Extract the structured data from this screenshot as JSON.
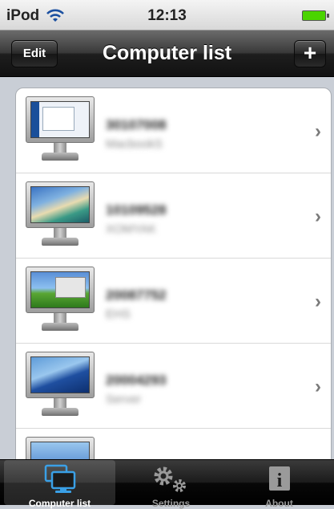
{
  "status_bar": {
    "carrier": "iPod",
    "time": "12:13"
  },
  "nav": {
    "edit_label": "Edit",
    "title": "Computer list",
    "add_label": "+"
  },
  "computers": [
    {
      "name": "30107008",
      "subtitle": "MacbookS"
    },
    {
      "name": "10109528",
      "subtitle": "XOMYAK"
    },
    {
      "name": "20087752",
      "subtitle": "EHS"
    },
    {
      "name": "20004293",
      "subtitle": "Server"
    }
  ],
  "tabs": [
    {
      "label": "Computer list",
      "icon": "computers-icon",
      "selected": true
    },
    {
      "label": "Settings",
      "icon": "gears-icon",
      "selected": false
    },
    {
      "label": "About",
      "icon": "info-icon",
      "selected": false
    }
  ],
  "colors": {
    "battery": "#4ad400",
    "selected_tab_icon": "#3aa0e6"
  }
}
